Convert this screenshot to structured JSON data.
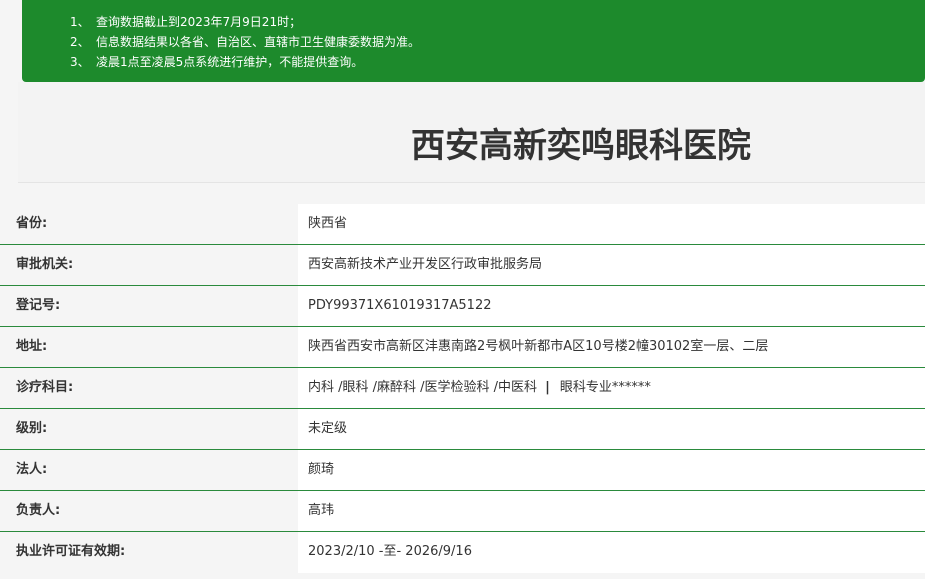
{
  "notice": {
    "items": [
      {
        "num": "1、",
        "text": "查询数据截止到2023年7月9日21时；"
      },
      {
        "num": "2、",
        "text": "信息数据结果以各省、自治区、直辖市卫生健康委数据为准。"
      },
      {
        "num": "3、",
        "text": "凌晨1点至凌晨5点系统进行维护，不能提供查询。"
      }
    ]
  },
  "title": "西安高新奕鸣眼科医院",
  "rows": [
    {
      "label": "省份:",
      "value": "陕西省"
    },
    {
      "label": "审批机关:",
      "value": "西安高新技术产业开发区行政审批服务局"
    },
    {
      "label": "登记号:",
      "value": "PDY99371X61019317A5122"
    },
    {
      "label": "地址:",
      "value": "陕西省西安市高新区沣惠南路2号枫叶新都市A区10号楼2幢30102室一层、二层"
    },
    {
      "label": "诊疗科目:",
      "value": "内科 /眼科 /麻醉科 /医学检验科 /中医科",
      "extra": "眼科专业******",
      "separator": "|"
    },
    {
      "label": "级别:",
      "value": "未定级"
    },
    {
      "label": "法人:",
      "value": "颜琦"
    },
    {
      "label": "负责人:",
      "value": "高玮"
    },
    {
      "label": "执业许可证有效期:",
      "value": "2023/2/10 -至- 2026/9/16"
    }
  ],
  "colors": {
    "notice_bg": "#1d8a2c",
    "row_border": "#2a8a3c"
  }
}
